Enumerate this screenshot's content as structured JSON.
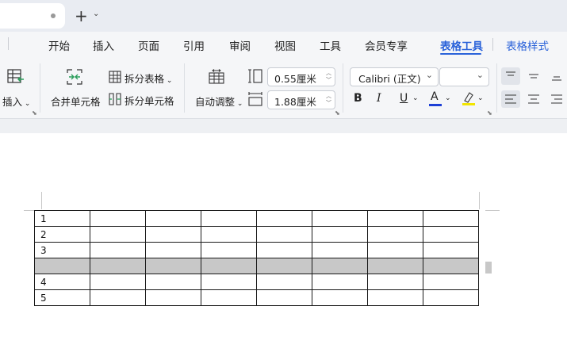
{
  "tab_strip": {
    "new_tab_label": "+"
  },
  "ribbon": {
    "tabs": [
      "开始",
      "插入",
      "页面",
      "引用",
      "审阅",
      "视图",
      "工具",
      "会员专享",
      "表格工具",
      "表格样式"
    ],
    "active_tab": "表格工具"
  },
  "toolbar": {
    "insert_label": "插入",
    "merge_cells_label": "合并单元格",
    "split_table_label": "拆分表格",
    "split_cells_label": "拆分单元格",
    "autofit_label": "自动调整",
    "row_height_value": "0.55厘米",
    "column_width_value": "1.88厘米",
    "font_name": "Calibri (正文)",
    "font_size": ""
  },
  "table": {
    "rows": [
      {
        "cells": [
          "1",
          "",
          "",
          "",
          "",
          "",
          "",
          ""
        ],
        "selected": false
      },
      {
        "cells": [
          "2",
          "",
          "",
          "",
          "",
          "",
          "",
          ""
        ],
        "selected": false
      },
      {
        "cells": [
          "3",
          "",
          "",
          "",
          "",
          "",
          "",
          ""
        ],
        "selected": false
      },
      {
        "cells": [
          "",
          "",
          "",
          "",
          "",
          "",
          "",
          ""
        ],
        "selected": true
      },
      {
        "cells": [
          "4",
          "",
          "",
          "",
          "",
          "",
          "",
          ""
        ],
        "selected": false
      },
      {
        "cells": [
          "5",
          "",
          "",
          "",
          "",
          "",
          "",
          ""
        ],
        "selected": false
      }
    ]
  },
  "colors": {
    "accent": "#2a62d9",
    "selected_row": "#c8c8c8",
    "font_color_underline": "#1d3fd6",
    "highlight_underline": "#f2e500"
  }
}
